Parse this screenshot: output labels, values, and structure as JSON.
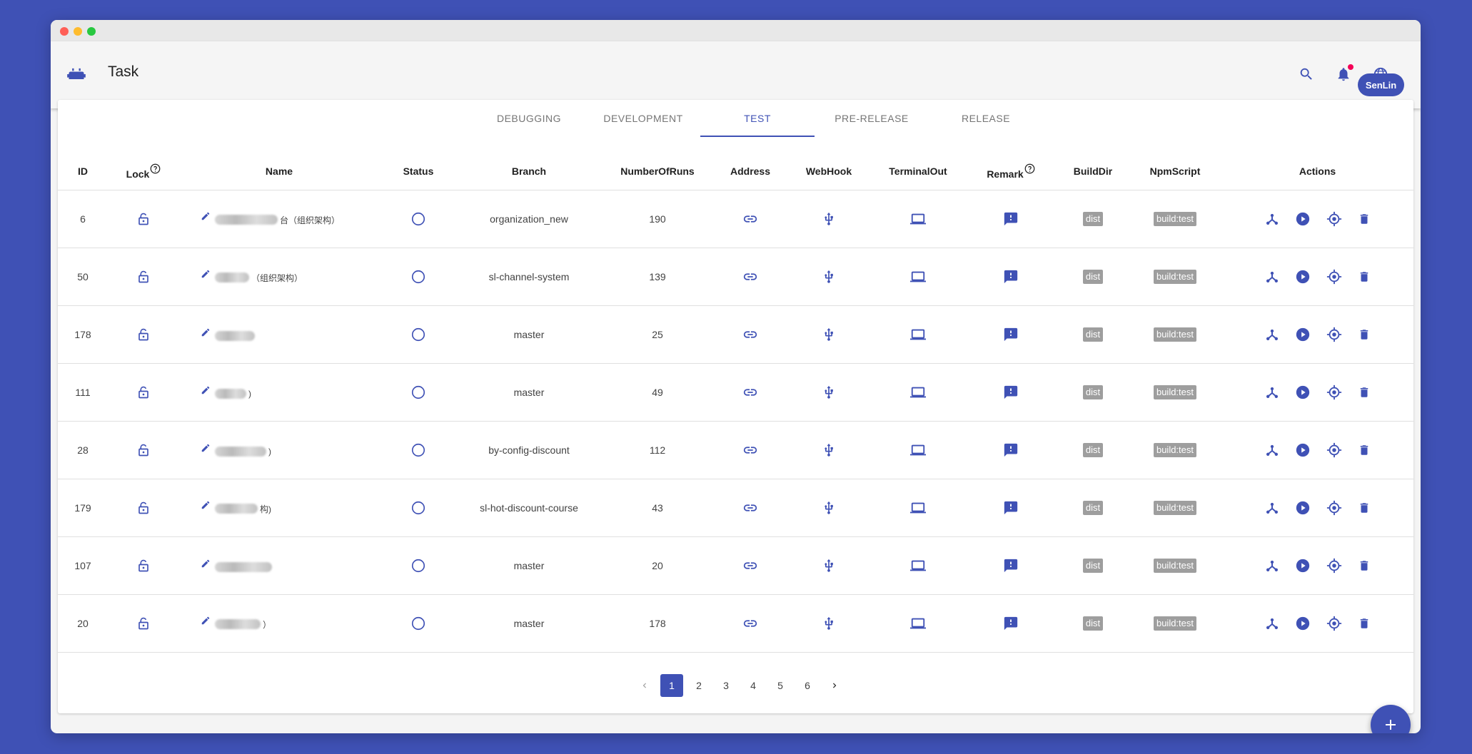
{
  "app": {
    "title": "Task",
    "user_label": "SenLin",
    "icons": [
      "robot-icon",
      "search-icon",
      "notifications-icon",
      "language-icon"
    ],
    "accent": "#3f51b5",
    "notification_dot": "#f50057"
  },
  "tabs": [
    "DEBUGGING",
    "DEVELOPMENT",
    "TEST",
    "PRE-RELEASE",
    "RELEASE"
  ],
  "active_tab": "TEST",
  "columns": [
    "ID",
    "Lock",
    "Name",
    "Status",
    "Branch",
    "NumberOfRuns",
    "Address",
    "WebHook",
    "TerminalOut",
    "Remark",
    "BuildDir",
    "NpmScript",
    "Actions"
  ],
  "rows": [
    {
      "id": "6",
      "name_suffix": "台（组织架构）",
      "branch": "organization_new",
      "runs": "190",
      "build_dir": "dist",
      "npm_script": "build:test"
    },
    {
      "id": "50",
      "name_suffix": "（组织架构）",
      "branch": "sl-channel-system",
      "runs": "139",
      "build_dir": "dist",
      "npm_script": "build:test"
    },
    {
      "id": "178",
      "name_suffix": "",
      "branch": "master",
      "runs": "25",
      "build_dir": "dist",
      "npm_script": "build:test"
    },
    {
      "id": "111",
      "name_suffix": ")",
      "branch": "master",
      "runs": "49",
      "build_dir": "dist",
      "npm_script": "build:test"
    },
    {
      "id": "28",
      "name_suffix": ")",
      "branch": "by-config-discount",
      "runs": "112",
      "build_dir": "dist",
      "npm_script": "build:test"
    },
    {
      "id": "179",
      "name_suffix": "构)",
      "branch": "sl-hot-discount-course",
      "runs": "43",
      "build_dir": "dist",
      "npm_script": "build:test"
    },
    {
      "id": "107",
      "name_suffix": "",
      "branch": "master",
      "runs": "20",
      "build_dir": "dist",
      "npm_script": "build:test"
    },
    {
      "id": "20",
      "name_suffix": "）",
      "branch": "master",
      "runs": "178",
      "build_dir": "dist",
      "npm_script": "build:test"
    }
  ],
  "pagination": {
    "pages": [
      "1",
      "2",
      "3",
      "4",
      "5",
      "6"
    ],
    "current": "1"
  }
}
